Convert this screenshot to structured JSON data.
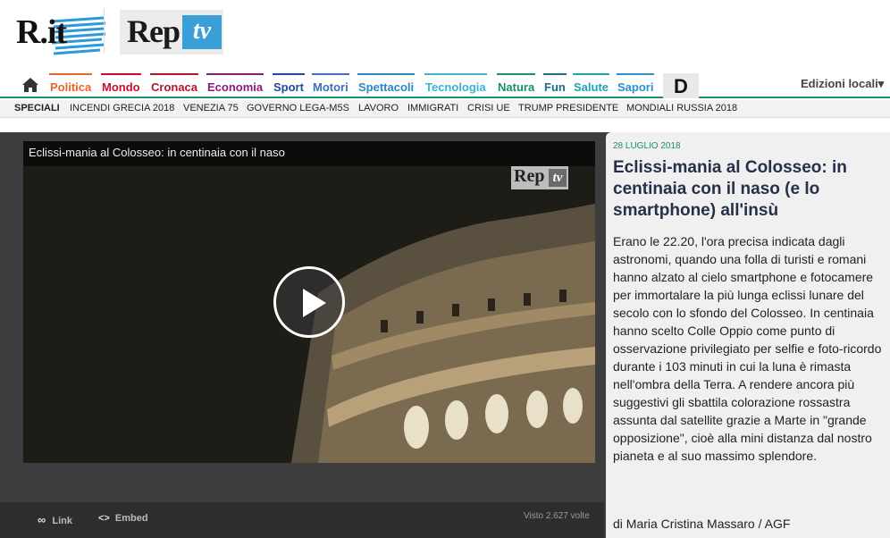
{
  "brand": {
    "rit_text": "R.it",
    "rep_text": "Rep",
    "tv_text": "tv"
  },
  "nav": {
    "items": [
      {
        "label": "Politica",
        "color": "#e8662a"
      },
      {
        "label": "Mondo",
        "color": "#c8102e"
      },
      {
        "label": "Cronaca",
        "color": "#b5172b"
      },
      {
        "label": "Economia",
        "color": "#8a1b7e"
      },
      {
        "label": "Sport",
        "color": "#1e4b9c"
      },
      {
        "label": "Motori",
        "color": "#3d6fbf"
      },
      {
        "label": "Spettacoli",
        "color": "#2d86c4"
      },
      {
        "label": "Tecnologia",
        "color": "#3bb3d6"
      },
      {
        "label": "Natura",
        "color": "#1a8f6e"
      },
      {
        "label": "Fun",
        "color": "#1b6b8f"
      },
      {
        "label": "Salute",
        "color": "#1fa3b5"
      },
      {
        "label": "Sapori",
        "color": "#2b8fd0"
      }
    ],
    "d_label": "D",
    "edizioni_label": "Edizioni locali"
  },
  "speciali": {
    "lead": "SPECIALI",
    "items": [
      "INCENDI GRECIA 2018",
      "VENEZIA 75",
      "GOVERNO LEGA-M5S",
      "LAVORO",
      "IMMIGRATI",
      "CRISI UE",
      "TRUMP PRESIDENTE",
      "MONDIALI RUSSIA 2018"
    ]
  },
  "video": {
    "title": "Eclissi-mania al Colosseo: in centinaia con il naso",
    "logo_rep": "Rep",
    "logo_tv": "tv"
  },
  "actions": {
    "link_label": "Link",
    "embed_label": "Embed",
    "views": "Visto 2.627 volte"
  },
  "article": {
    "date": "28 LUGLIO 2018",
    "title": "Eclissi-mania al Colosseo: in centinaia con il naso (e lo smartphone) all'insù",
    "body": "Erano le 22.20, l'ora precisa indicata dagli astronomi, quando una folla di turisti e romani hanno alzato al cielo smartphone e fotocamere per immortalare la più lunga eclissi lunare del secolo con lo sfondo del Colosseo. In centinaia hanno scelto Colle Oppio come punto di osservazione privilegiato per selfie e foto-ricordo durante i 103 minuti in cui la luna è rimasta nell'ombra della Terra. A rendere ancora più suggestivi gli sbattila colorazione rossastra assunta dal satellite grazie a Marte in \"grande opposizione\", cioè alla mini distanza dal nostro pianeta e al suo massimo splendore.",
    "author": "di Maria Cristina Massaro / AGF"
  }
}
